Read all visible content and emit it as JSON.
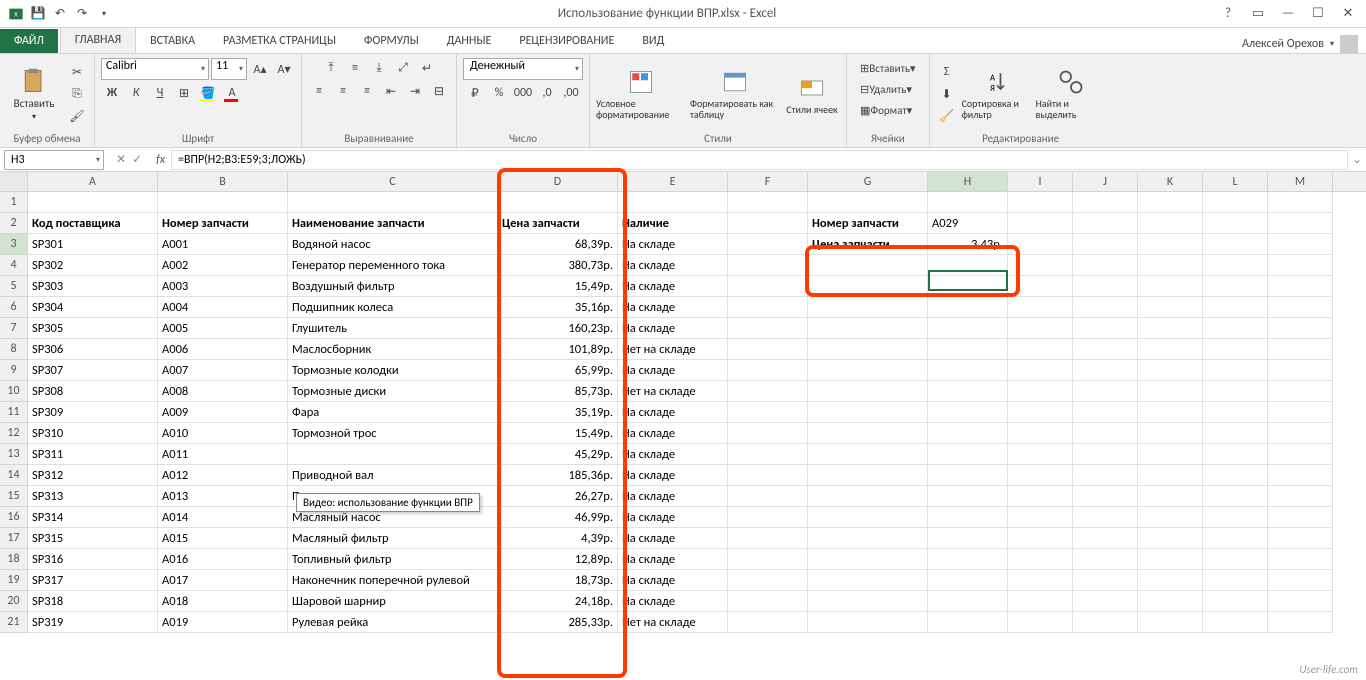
{
  "titlebar": {
    "title": "Использование функции ВПР.xlsx - Excel"
  },
  "user": {
    "name": "Алексей Орехов"
  },
  "tabs": {
    "file": "ФАЙЛ",
    "home": "ГЛАВНАЯ",
    "insert": "ВСТАВКА",
    "layout": "РАЗМЕТКА СТРАНИЦЫ",
    "formulas": "ФОРМУЛЫ",
    "data": "ДАННЫЕ",
    "review": "РЕЦЕНЗИРОВАНИЕ",
    "view": "ВИД"
  },
  "ribbon": {
    "clipboard": {
      "paste": "Вставить",
      "label": "Буфер обмена"
    },
    "font": {
      "name": "Calibri",
      "size": "11",
      "label": "Шрифт"
    },
    "alignment": {
      "label": "Выравнивание"
    },
    "number": {
      "format": "Денежный",
      "label": "Число"
    },
    "styles": {
      "cond": "Условное форматирование",
      "table": "Форматировать как таблицу",
      "cell": "Стили ячеек",
      "label": "Стили"
    },
    "cells": {
      "insert": "Вставить",
      "delete": "Удалить",
      "format": "Формат",
      "label": "Ячейки"
    },
    "editing": {
      "sort": "Сортировка и фильтр",
      "find": "Найти и выделить",
      "label": "Редактирование"
    }
  },
  "formula_bar": {
    "name_box": "H3",
    "formula": "=ВПР(H2;B3:E59;3;ЛОЖЬ)"
  },
  "columns": [
    "A",
    "B",
    "C",
    "D",
    "E",
    "F",
    "G",
    "H",
    "I",
    "J",
    "K",
    "L",
    "M"
  ],
  "headers": {
    "A": "Код поставщика",
    "B": "Номер запчасти",
    "C": "Наименование запчасти",
    "D": "Цена запчасти",
    "E": "Наличие",
    "G": "Номер запчасти",
    "H": "A029",
    "G3": "Цена запчасти",
    "H3": "3,43р."
  },
  "rows": [
    {
      "n": 3,
      "A": "SP301",
      "B": "A001",
      "C": "Водяной насос",
      "D": "68,39р.",
      "E": "На складе"
    },
    {
      "n": 4,
      "A": "SP302",
      "B": "A002",
      "C": "Генератор переменного тока",
      "D": "380,73р.",
      "E": "На складе"
    },
    {
      "n": 5,
      "A": "SP303",
      "B": "A003",
      "C": "Воздушный фильтр",
      "D": "15,49р.",
      "E": "На складе"
    },
    {
      "n": 6,
      "A": "SP304",
      "B": "A004",
      "C": "Подшипник колеса",
      "D": "35,16р.",
      "E": "На складе"
    },
    {
      "n": 7,
      "A": "SP305",
      "B": "A005",
      "C": "Глушитель",
      "D": "160,23р.",
      "E": "На складе"
    },
    {
      "n": 8,
      "A": "SP306",
      "B": "A006",
      "C": "Маслосборник",
      "D": "101,89р.",
      "E": "Нет на складе"
    },
    {
      "n": 9,
      "A": "SP307",
      "B": "A007",
      "C": "Тормозные колодки",
      "D": "65,99р.",
      "E": "На складе"
    },
    {
      "n": 10,
      "A": "SP308",
      "B": "A008",
      "C": "Тормозные диски",
      "D": "85,73р.",
      "E": "Нет на складе"
    },
    {
      "n": 11,
      "A": "SP309",
      "B": "A009",
      "C": "Фара",
      "D": "35,19р.",
      "E": "На складе"
    },
    {
      "n": 12,
      "A": "SP310",
      "B": "A010",
      "C": "Тормозной трос",
      "D": "15,49р.",
      "E": "На складе"
    },
    {
      "n": 13,
      "A": "SP311",
      "B": "A011",
      "C": "",
      "D": "45,29р.",
      "E": "На складе"
    },
    {
      "n": 14,
      "A": "SP312",
      "B": "A012",
      "C": "Приводной вал",
      "D": "185,36р.",
      "E": "На складе"
    },
    {
      "n": 15,
      "A": "SP313",
      "B": "A013",
      "C": "Пыльник в комплекте",
      "D": "26,27р.",
      "E": "На складе"
    },
    {
      "n": 16,
      "A": "SP314",
      "B": "A014",
      "C": "Масляный насос",
      "D": "46,99р.",
      "E": "На складе"
    },
    {
      "n": 17,
      "A": "SP315",
      "B": "A015",
      "C": "Масляный фильтр",
      "D": "4,39р.",
      "E": "На складе"
    },
    {
      "n": 18,
      "A": "SP316",
      "B": "A016",
      "C": "Топливный фильтр",
      "D": "12,89р.",
      "E": "На складе"
    },
    {
      "n": 19,
      "A": "SP317",
      "B": "A017",
      "C": "Наконечник поперечной рулевой",
      "D": "18,73р.",
      "E": "На складе"
    },
    {
      "n": 20,
      "A": "SP318",
      "B": "A018",
      "C": "Шаровой шарнир",
      "D": "24,18р.",
      "E": "На складе"
    },
    {
      "n": 21,
      "A": "SP319",
      "B": "A019",
      "C": "Рулевая рейка",
      "D": "285,33р.",
      "E": "Нет на складе"
    }
  ],
  "tooltip": "Видео: использование функции ВПР",
  "watermark": "User-life.com"
}
